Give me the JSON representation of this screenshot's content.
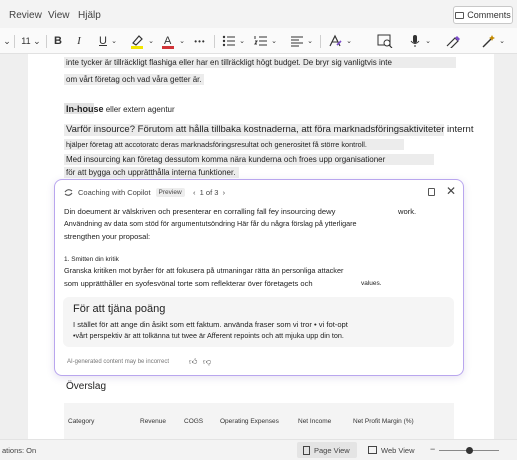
{
  "menu": {
    "review": "Review",
    "view": "View",
    "help": "Hjälp",
    "comments": "Comments"
  },
  "toolbar": {
    "font_size": "11",
    "bold": "B",
    "italic": "I",
    "underline": "U",
    "more": "•••"
  },
  "doc": {
    "line1": "inte tycker är tillräckligt flashiga eller har en tillräckligt högt budget. De bryr sig vanligtvis inte",
    "line2": "om vårt företag och vad våra getter är.",
    "heading": "In-house",
    "heading_rest": " eller extern agentur",
    "q1": "Varför insource? Förutom att hålla tillbaka kostnaderna, att föra marknadsföringsaktiviteter internt",
    "q2": "hjälper företag att accotoratc deras marknadsföringsresultat och generositet få större kontroll.",
    "q3": "Med insourcing kan företag dessutom komma nära kunderna och froes upp organisationer",
    "q4": "för att bygga och upprätthålla interna funktioner.",
    "overslag": "Överslag",
    "table_headers": [
      "Category",
      "Revenue",
      "COGS",
      "Operating Expenses",
      "Net Income",
      "Net Profit Margin (%)"
    ]
  },
  "coach": {
    "title": "Coaching with Copilot",
    "badge": "Preview",
    "pager": "1 of 3",
    "intro1": "Din doeument är välskriven och presenterar en corralling fall fey insourcing dewy",
    "intro1b": "work.",
    "intro2": "Användning av data som stöd för argumentutsöndring Här får du några förslag på ytterligare",
    "intro3": "strengthen your proposal:",
    "item1": "1. Smitten din kritik",
    "item2": "Granska kritiken mot byråer för att fokusera på utmaningar rätta än personliga attacker",
    "item3": "som upprätthåller en syofesvönal torte som reflekterar över företagets och",
    "item3b": "values.",
    "sug_title": "För att tjäna poäng",
    "sug1": "I stället för att ange din åsikt som ett faktum. använda fraser som vi tror • vi fot-opt",
    "sug2": "•vårt perspektiv är  att tolkänna tut twee är Afferent repoints och att mjuka upp din ton.",
    "footer": "AI-generated content may be incorrect"
  },
  "status": {
    "left": "ations: On",
    "page_view": "Page View",
    "web_view": "Web View",
    "zoom": 0.5
  },
  "colors": {
    "accent": "#b9a6ee",
    "highlight": "#f2e600",
    "font_color": "#d13438"
  }
}
